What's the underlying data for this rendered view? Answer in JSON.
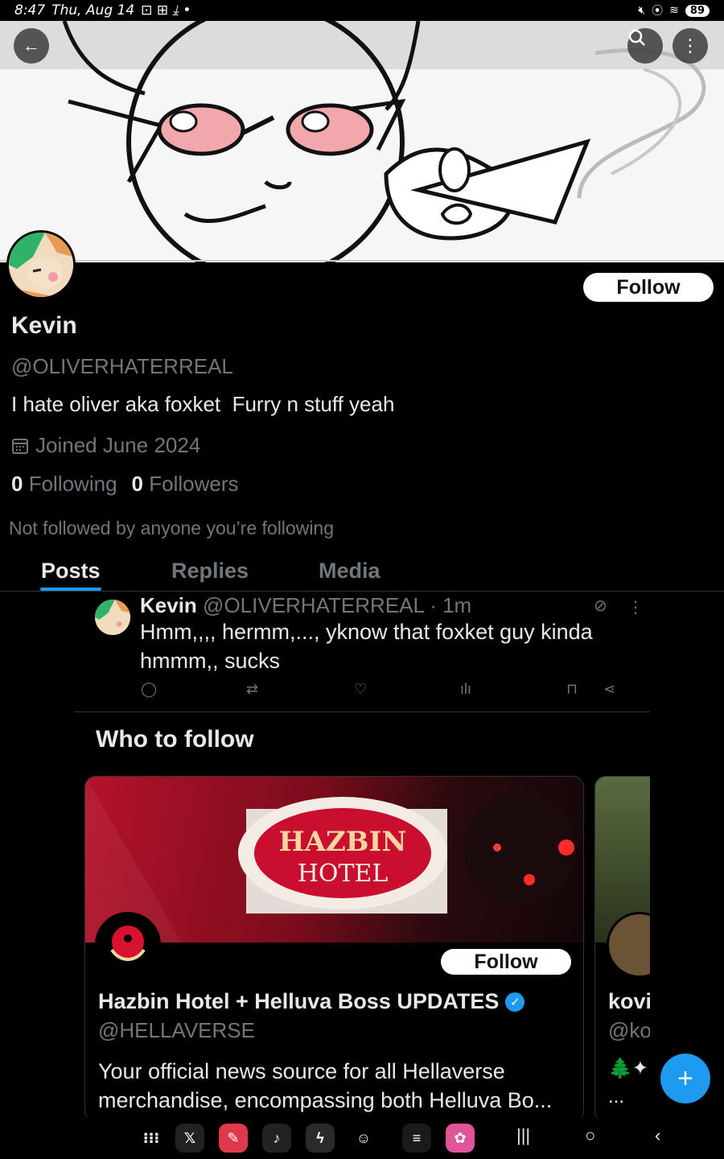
{
  "status_bar": {
    "time": "8:47",
    "date": "Thu, Aug 14",
    "battery": "89"
  },
  "header": {
    "back_icon": "arrow-left-icon",
    "search_icon": "search-icon",
    "more_icon": "more-vertical-icon"
  },
  "profile": {
    "name": "Kevin",
    "handle": "@OLIVERHATERREAL",
    "bio": "I hate oliver aka foxket  Furry n stuff yeah",
    "joined": "Joined June 2024",
    "following_count": "0",
    "following_label": "Following",
    "followers_count": "0",
    "followers_label": "Followers",
    "not_followed_note": "Not followed by anyone you’re following",
    "follow_label": "Follow"
  },
  "tabs": [
    {
      "label": "Posts",
      "active": true
    },
    {
      "label": "Replies",
      "active": false
    },
    {
      "label": "Media",
      "active": false
    }
  ],
  "post": {
    "author_name": "Kevin",
    "author_handle": "@OLIVERHATERREAL",
    "time": "· 1m",
    "text": "Hmm,,,, hermm,..., yknow that foxket guy kinda hmmm,, sucks"
  },
  "who_to_follow": {
    "title": "Who to follow",
    "cards": [
      {
        "name": "Hazbin Hotel + Helluva Boss UPDATES",
        "handle": "@HELLAVERSE",
        "description": "Your official news source for all Hellaverse merchandise, encompassing both Helluva Bo...",
        "follow_label": "Follow",
        "verified": true
      },
      {
        "name": "kovi",
        "handle": "@ko",
        "description": "🌲✦",
        "more": "..."
      }
    ]
  },
  "fab": {
    "label": "+"
  },
  "colors": {
    "accent": "#1d9bf0",
    "background": "#000000",
    "text_primary": "#e7e9ea",
    "text_secondary": "#71767b"
  }
}
